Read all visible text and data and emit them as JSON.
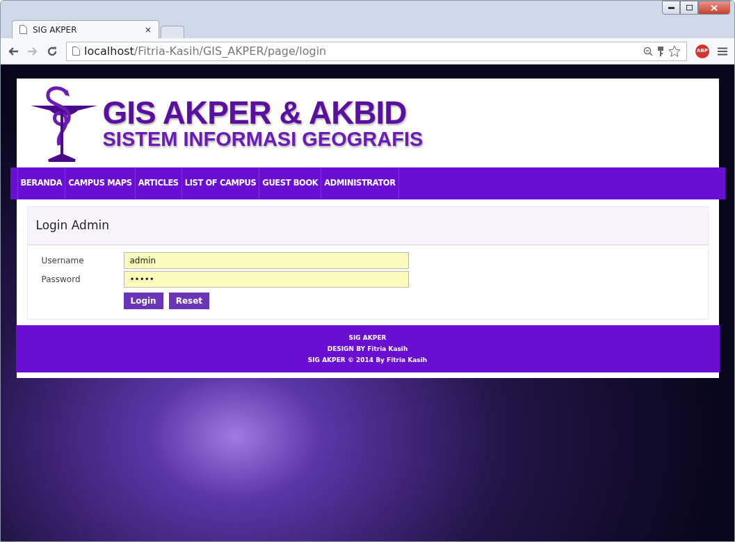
{
  "browser": {
    "tab_title": "SIG AKPER",
    "tab_close": "×",
    "address": {
      "host": "localhost",
      "path": "/Fitria-Kasih/GIS_AKPER/page/login"
    },
    "extension_badge": "ABP"
  },
  "header": {
    "title": "GIS AKPER & AKBID",
    "subtitle": "SISTEM INFORMASI GEOGRAFIS"
  },
  "nav": [
    "BERANDA",
    "CAMPUS MAPS",
    "ARTICLES",
    "LIST OF CAMPUS",
    "GUEST BOOK",
    "ADMINISTRATOR"
  ],
  "login": {
    "title": "Login Admin",
    "fields": [
      {
        "label": "Username",
        "value": "admin"
      },
      {
        "label": "Password",
        "value": "•••••"
      }
    ],
    "buttons": [
      "Login",
      "Reset"
    ]
  },
  "footer": [
    "SIG AKPER",
    "DESIGN BY Fitria Kasih",
    "SIG AKPER © 2014 By Fitria Kasih"
  ]
}
